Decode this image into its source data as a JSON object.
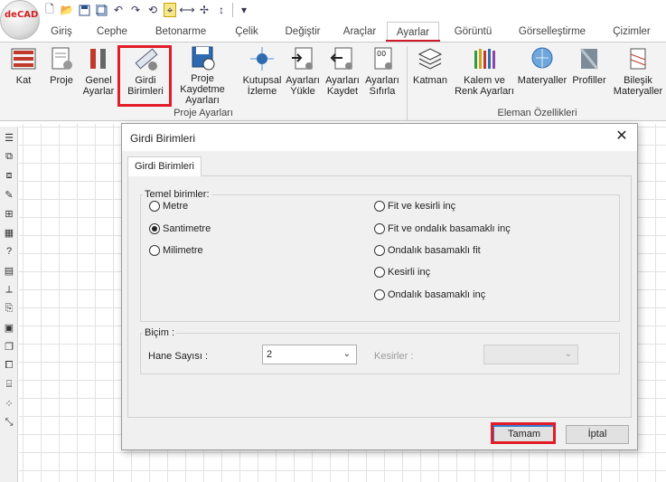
{
  "app": {
    "logo_text": "deCAD"
  },
  "quick_access": {
    "icons": [
      "new-file-icon",
      "open-folder-icon",
      "save-icon",
      "save-all-icon",
      "undo-icon",
      "redo-icon",
      "refresh-icon",
      "snap-icon",
      "measure-icon",
      "trim-icon",
      "text-height-icon",
      "dropdown-icon"
    ]
  },
  "tabs": [
    "Giriş",
    "Cephe",
    "Betonarme",
    "Çelik",
    "Değiştir",
    "Araçlar",
    "Ayarlar",
    "Görüntü",
    "Görselleştirme",
    "Çizimler"
  ],
  "active_tab": "Ayarlar",
  "ribbon": {
    "group1": {
      "label": "Proje Ayarları",
      "buttons": [
        {
          "l1": "Kat",
          "l2": ""
        },
        {
          "l1": "Proje",
          "l2": ""
        },
        {
          "l1": "Genel",
          "l2": "Ayarlar"
        },
        {
          "l1": "Girdi",
          "l2": "Birimleri"
        },
        {
          "l1": "Proje Kaydetme",
          "l2": "Ayarları"
        },
        {
          "l1": "Kutupsal",
          "l2": "İzleme"
        },
        {
          "l1": "Ayarları",
          "l2": "Yükle"
        },
        {
          "l1": "Ayarları",
          "l2": "Kaydet"
        },
        {
          "l1": "Ayarları",
          "l2": "Sıfırla"
        }
      ]
    },
    "group2": {
      "label": "Eleman Özellikleri",
      "buttons": [
        {
          "l1": "Katman",
          "l2": ""
        },
        {
          "l1": "Kalem ve",
          "l2": "Renk Ayarları"
        },
        {
          "l1": "Materyaller",
          "l2": ""
        },
        {
          "l1": "Profiller",
          "l2": ""
        },
        {
          "l1": "Bileşik",
          "l2": "Materyaller"
        }
      ]
    }
  },
  "dialog": {
    "title": "Girdi Birimleri",
    "tab_label": "Girdi Birimleri",
    "units_group": {
      "legend": "Temel birimler:",
      "left_options": [
        "Metre",
        "Santimetre",
        "Milimetre"
      ],
      "right_options": [
        "Fit ve kesirli inç",
        "Fit ve ondalık basamaklı inç",
        "Ondalık basamaklı fit",
        "Kesirli inç",
        "Ondalık basamaklı inç"
      ],
      "selected": "Santimetre"
    },
    "format_group": {
      "legend": "Biçim :",
      "decimals_label": "Hane Sayısı :",
      "decimals_value": "2",
      "fractions_label": "Kesirler :",
      "fractions_value": ""
    },
    "ok_label": "Tamam",
    "cancel_label": "İptal"
  }
}
